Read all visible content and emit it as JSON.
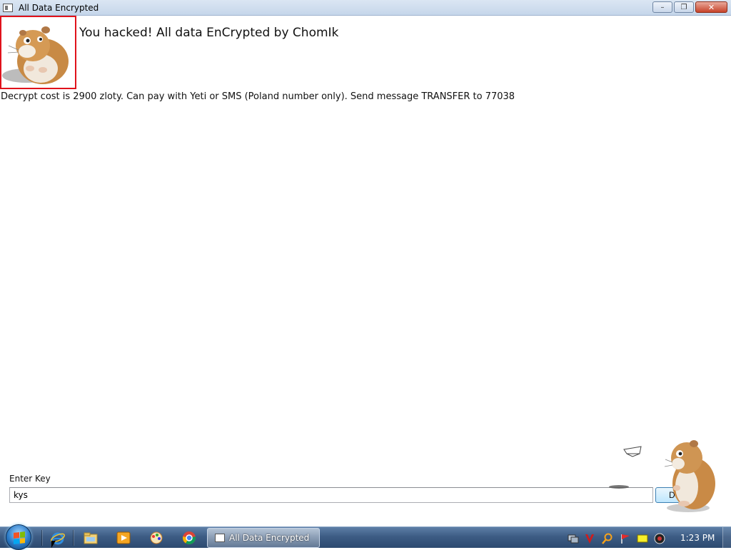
{
  "window": {
    "title": "All Data Encrypted",
    "controls": {
      "minimize": "–",
      "maximize": "❐",
      "close": "✕"
    }
  },
  "content": {
    "headline": "You hacked! All data EnCrypted by ChomIk",
    "ransom_note": "Decrypt cost is 2900 zloty. Can pay with Yeti or SMS (Poland number only). Send message TRANSFER to 77038",
    "logo_icon": "hamster-image",
    "key_form": {
      "label": "Enter Key",
      "value": "kys",
      "button_label": "D"
    }
  },
  "taskbar": {
    "start_icon": "windows-start-orb",
    "pinned": [
      "internet-explorer-icon",
      "explorer-folder-icon",
      "media-player-icon",
      "paint-icon",
      "chrome-icon"
    ],
    "active_task_label": "All Data Encrypted",
    "tray_icons": [
      "network-tray-icon",
      "antivirus-tray-icon",
      "search-tray-icon",
      "flag-tray-icon",
      "notes-tray-icon",
      "volume-tray-icon"
    ],
    "clock": "1:23 PM"
  },
  "colors": {
    "logo_border": "#e0121b",
    "taskbar": "#3d5c84"
  }
}
